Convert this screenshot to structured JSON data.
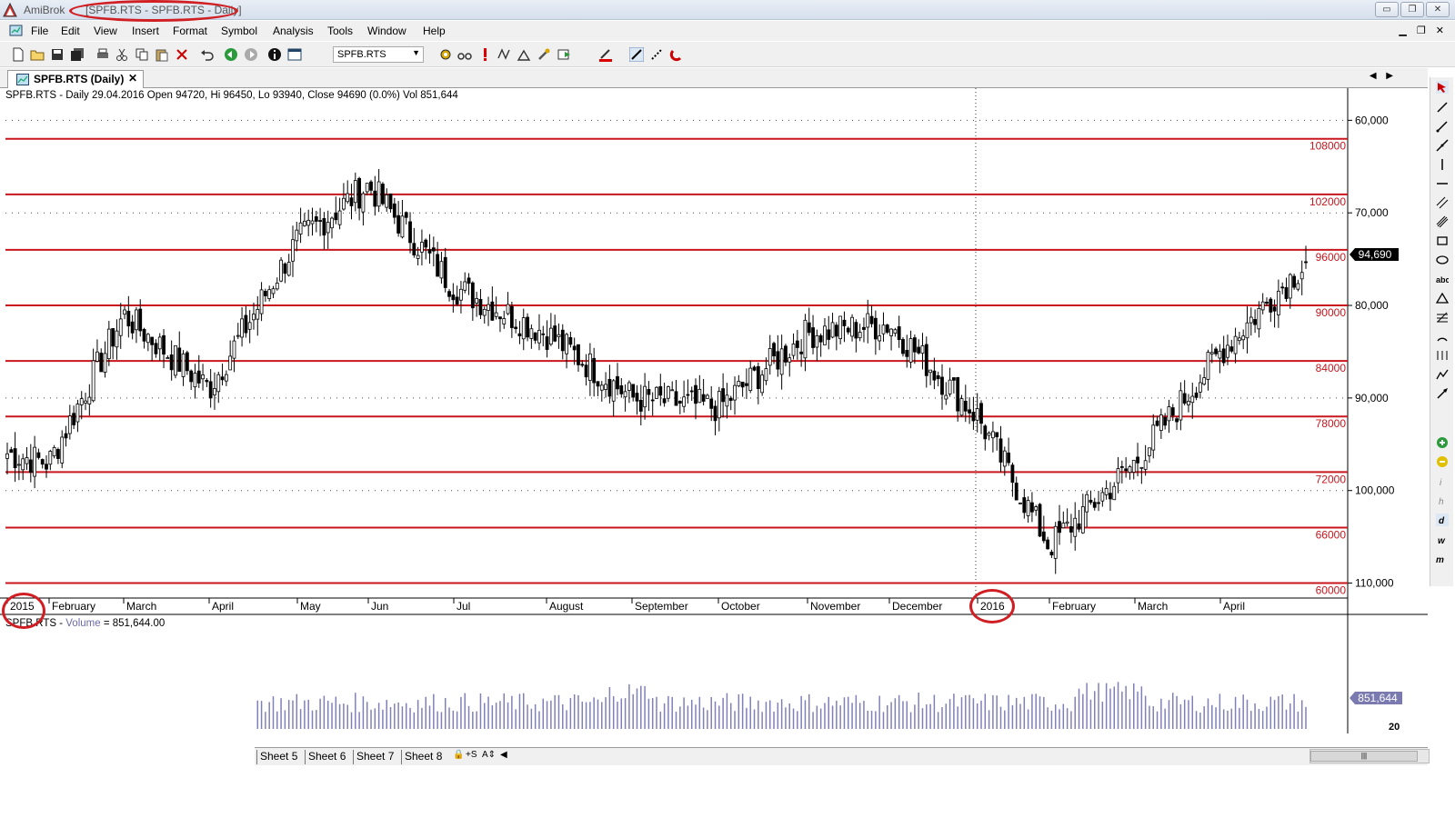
{
  "window": {
    "app_name": "AmiBrok",
    "doc_title": "[SPFB.RTS - SPFB.RTS - Daily]",
    "buttons": [
      "▭",
      "❐",
      "✕"
    ]
  },
  "menu": {
    "items": [
      "File",
      "Edit",
      "View",
      "Insert",
      "Format",
      "Symbol",
      "Analysis",
      "Tools",
      "Window",
      "Help"
    ],
    "mdi_buttons": "▁ ❐ ✕"
  },
  "toolbar": {
    "symbol_value": "SPFB.RTS"
  },
  "tab": {
    "label": "SPFB.RTS (Daily)",
    "close": "✕",
    "nav": "◀ ▶"
  },
  "price_pane": {
    "header": "SPFB.RTS - Daily 29.04.2016 Open 94720, Hi 96450, Lo 93940, Close 94690 (0.0%) Vol 851,644",
    "last_price_label": "94,690",
    "y_axis_ticks": [
      "110,000",
      "100,000",
      "90,000",
      "80,000",
      "70,000",
      "60,000"
    ],
    "level_labels": [
      "108000",
      "102000",
      "96000",
      "90000",
      "84000",
      "78000",
      "72000",
      "66000",
      "60000"
    ]
  },
  "x_axis": {
    "labels": [
      "2015",
      "February",
      "March",
      "April",
      "May",
      "Jun",
      "Jul",
      "August",
      "September",
      "October",
      "November",
      "December",
      "2016",
      "February",
      "March",
      "April"
    ]
  },
  "volume_pane": {
    "header_symbol": "SPFB.RTS",
    "header_sep": " - ",
    "header_indicator": "Volume",
    "header_value": " = 851,644.00",
    "last_value_label": "851,644",
    "axis_label": "20"
  },
  "sheets": {
    "tabs": [
      "Sheet 5",
      "Sheet 6",
      "Sheet 7",
      "Sheet 8"
    ],
    "controls": [
      "🔒",
      "+S",
      "A⇕",
      "◀"
    ],
    "scroll_thumb": "|||"
  },
  "colors": {
    "level_line": "#c8161d",
    "candle": "#000000",
    "volume_bar": "#8080b8",
    "annotation": "#d01e23"
  },
  "chart_data": {
    "type": "candlestick",
    "symbol": "SPFB.RTS",
    "interval": "Daily",
    "ylim": [
      57500,
      112000
    ],
    "y_ticks": [
      60000,
      70000,
      80000,
      90000,
      100000,
      110000
    ],
    "horizontal_levels": [
      108000,
      102000,
      96000,
      90000,
      84000,
      78000,
      72000,
      66000,
      60000
    ],
    "last_bar": {
      "date": "29.04.2016",
      "open": 94720,
      "high": 96450,
      "low": 93940,
      "close": 94690,
      "volume": 851644
    },
    "months": [
      "2015",
      "February",
      "March",
      "April",
      "May",
      "Jun",
      "Jul",
      "August",
      "September",
      "October",
      "November",
      "December",
      "2016",
      "February",
      "March",
      "April"
    ],
    "approx_closes_by_month_end": [
      73000,
      89000,
      81000,
      97000,
      103000,
      92000,
      87000,
      80000,
      79000,
      87000,
      88000,
      78000,
      64000,
      73000,
      85000,
      94690
    ]
  }
}
